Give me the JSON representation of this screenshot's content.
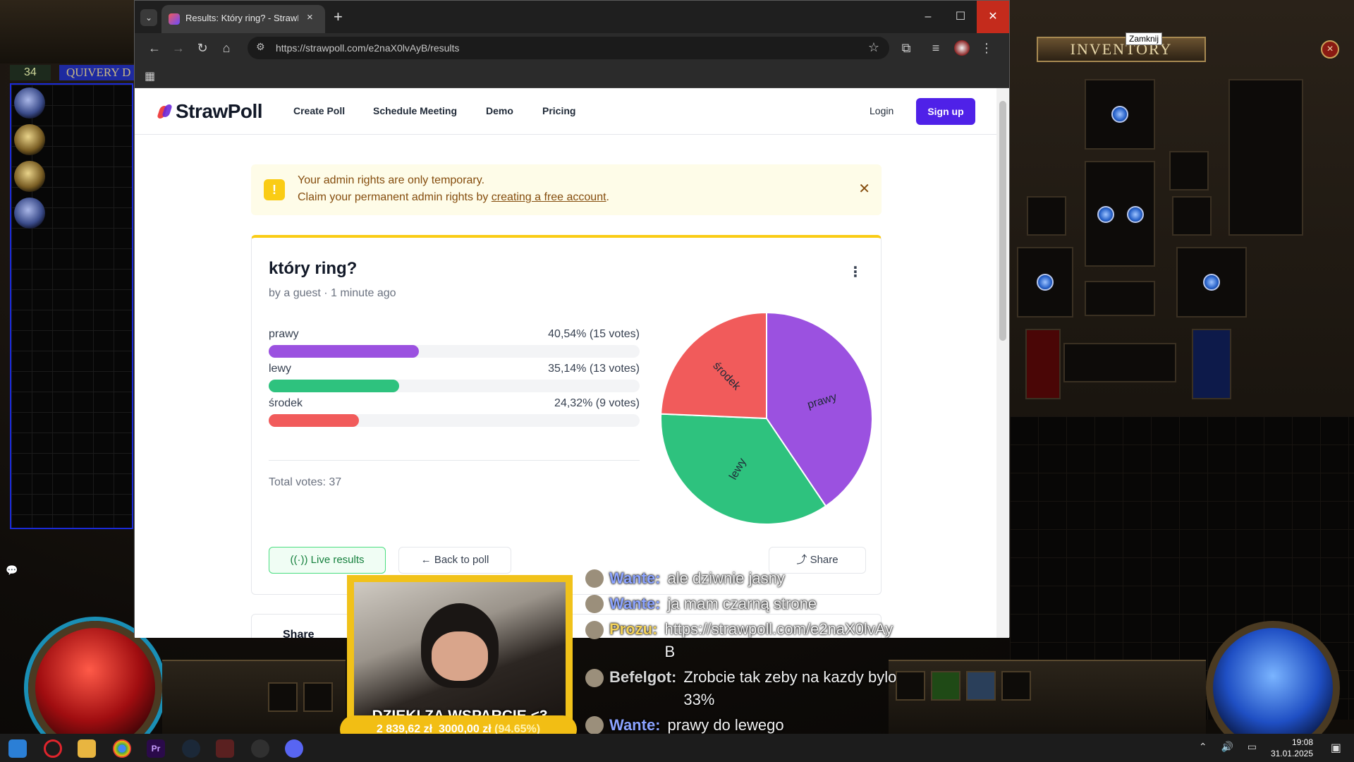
{
  "game": {
    "stash_level": "34",
    "stash_tab": "QUIVERY D",
    "inventory_title": "INVENTORY",
    "inventory_close": "×"
  },
  "browser": {
    "tab_title": "Results: Który ring? - StrawPoll",
    "tab_close": "×",
    "new_tab": "+",
    "url": "https://strawpoll.com/e2naX0lvAyB/results",
    "tooltip": "Zamknij",
    "minimize": "–",
    "maximize": "☐",
    "close": "✕"
  },
  "site": {
    "logo": "StrawPoll",
    "nav": [
      "Create Poll",
      "Schedule Meeting",
      "Demo",
      "Pricing"
    ],
    "login": "Login",
    "signup": "Sign up"
  },
  "alert": {
    "line1": "Your admin rights are only temporary.",
    "line2_prefix": "Claim your permanent admin rights by ",
    "line2_link": "creating a free account",
    "line2_suffix": ".",
    "close": "✕"
  },
  "poll": {
    "title": "który ring?",
    "meta": "by a guest · 1 minute ago",
    "total": "Total votes: 37",
    "live_results": "Live results",
    "back_to_poll": "Back to poll",
    "share": "Share",
    "share_section": "Share",
    "results": [
      {
        "label": "prawy",
        "value": "40,54% (15 votes)",
        "percent": 40.54,
        "color": "#9b51e0"
      },
      {
        "label": "lewy",
        "value": "35,14% (13 votes)",
        "percent": 35.14,
        "color": "#2ec27e"
      },
      {
        "label": "środek",
        "value": "24,32% (9 votes)",
        "percent": 24.32,
        "color": "#f15b5b"
      }
    ]
  },
  "chart_data": {
    "type": "pie",
    "categories": [
      "prawy",
      "lewy",
      "środek"
    ],
    "values": [
      15,
      13,
      9
    ],
    "colors": [
      "#9b51e0",
      "#2ec27e",
      "#f15b5b"
    ]
  },
  "stream": {
    "caption": "DZIĘKI ZA WSPARCIE <3",
    "donation_amount": "2 839,62 zł",
    "donation_goal": "3000,00 zł",
    "donation_percent": "(94.65%)",
    "chat": [
      {
        "user": "Wante:",
        "text": "ale dziwnie jasny"
      },
      {
        "user": "Wante:",
        "text": "ja mam czarną strone"
      },
      {
        "user": "Prozu:",
        "text": "https://strawpoll.com/e2naX0lvAyB"
      },
      {
        "user": "Befelgot:",
        "text": "Zrobcie tak zeby na kazdy bylo 33%"
      },
      {
        "user": "Wante:",
        "text": "prawy do lewego"
      }
    ]
  },
  "taskbar": {
    "time": "19:08",
    "date": "31.01.2025"
  }
}
